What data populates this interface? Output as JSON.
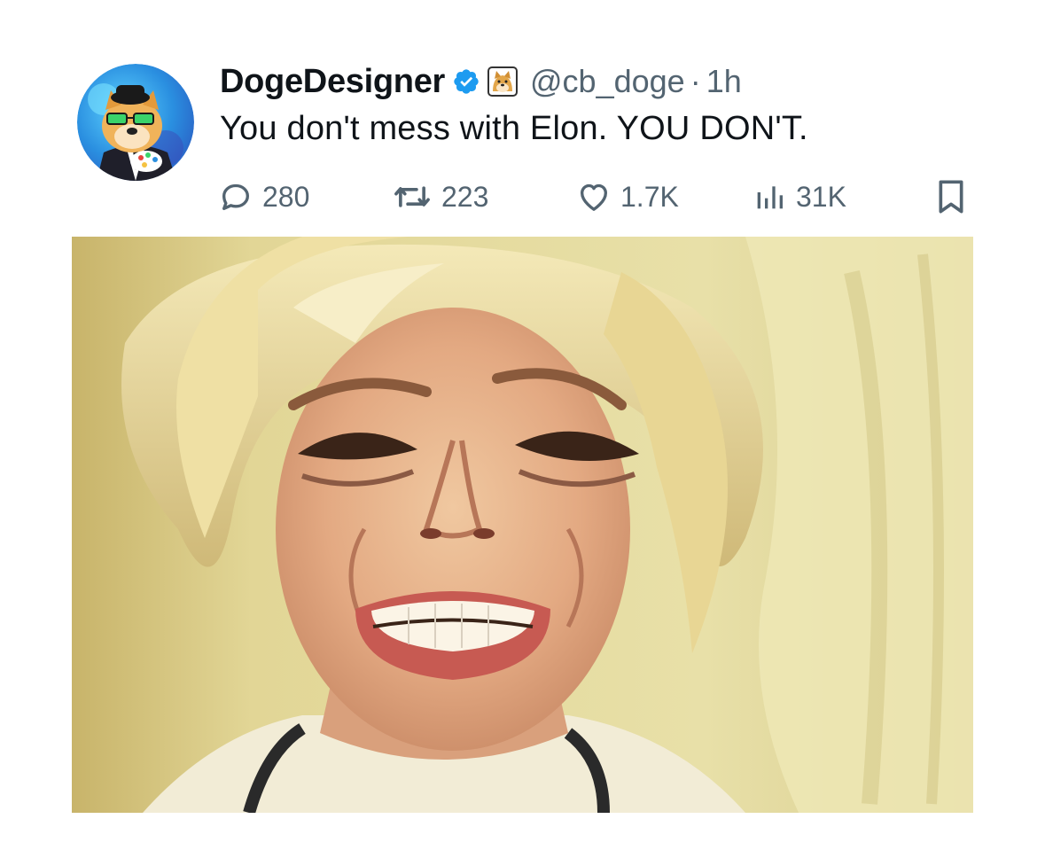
{
  "author": {
    "display_name": "DogeDesigner",
    "handle": "@cb_doge",
    "separator": "·",
    "time": "1h",
    "verified": true,
    "verified_color": "#1d9bf0"
  },
  "tweet": {
    "text": "You don't mess with Elon. YOU DON'T."
  },
  "actions": {
    "replies": {
      "icon": "reply-icon",
      "count": "280"
    },
    "reposts": {
      "icon": "repost-icon",
      "count": "223"
    },
    "likes": {
      "icon": "heart-icon",
      "count": "1.7K"
    },
    "views": {
      "icon": "views-icon",
      "count": "31K"
    },
    "bookmark": {
      "icon": "bookmark-icon"
    }
  },
  "media": {
    "type": "photo",
    "description_icon": "crying-face-photo"
  },
  "colors": {
    "text_primary": "#0f1419",
    "text_secondary": "#536471",
    "accent": "#1d9bf0"
  }
}
